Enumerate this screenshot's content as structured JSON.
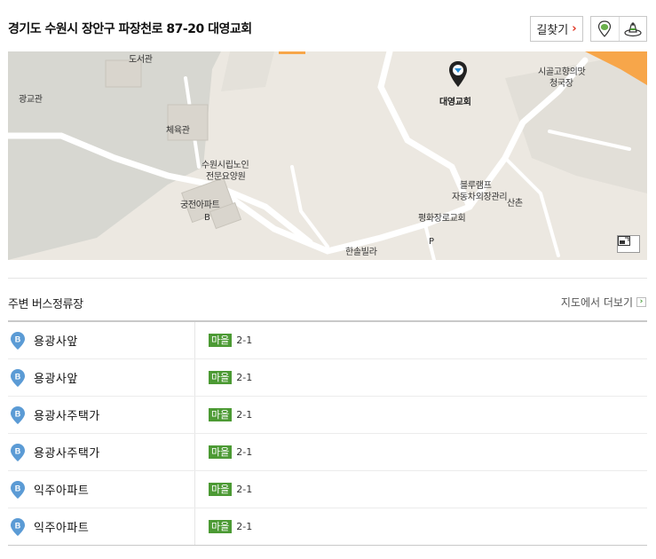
{
  "header": {
    "address": "경기도 수원시 장안구 파장천로 87-20 대영교회",
    "route_button_label": "길찾기",
    "route_button_chevron": "›",
    "icons": [
      "map-pin-traffic-icon",
      "road-view-icon"
    ]
  },
  "map": {
    "labels": {
      "place": "대영교회",
      "restaurant_line1": "시골고향의맛",
      "restaurant_line2": "청국장",
      "library": "도서관",
      "hall": "광교관",
      "gym": "체육관",
      "nursing_line1": "수원시립노인",
      "nursing_line2": "전문요양원",
      "apartment": "궁전아파트",
      "apt_b": "B",
      "bluelamp": "블루램프",
      "repair": "자동차외장관리",
      "village": "산촌",
      "church": "평화장로교회",
      "villa": "한솔빌라",
      "p": "P"
    },
    "colors": {
      "base": "#ece8e1",
      "road": "#ffffff",
      "green": "#d7d7d1",
      "orange": "#f7a64a"
    }
  },
  "nearby": {
    "title": "주변 버스정류장",
    "more_label": "지도에서 더보기",
    "more_icon": "›",
    "stops": [
      {
        "badge": "B",
        "name": "용광사앞",
        "route_type": "마을",
        "route_no": "2-1"
      },
      {
        "badge": "B",
        "name": "용광사앞",
        "route_type": "마을",
        "route_no": "2-1"
      },
      {
        "badge": "B",
        "name": "용광사주택가",
        "route_type": "마을",
        "route_no": "2-1"
      },
      {
        "badge": "B",
        "name": "용광사주택가",
        "route_type": "마을",
        "route_no": "2-1"
      },
      {
        "badge": "B",
        "name": "익주아파트",
        "route_type": "마을",
        "route_no": "2-1"
      },
      {
        "badge": "B",
        "name": "익주아파트",
        "route_type": "마을",
        "route_no": "2-1"
      }
    ]
  }
}
